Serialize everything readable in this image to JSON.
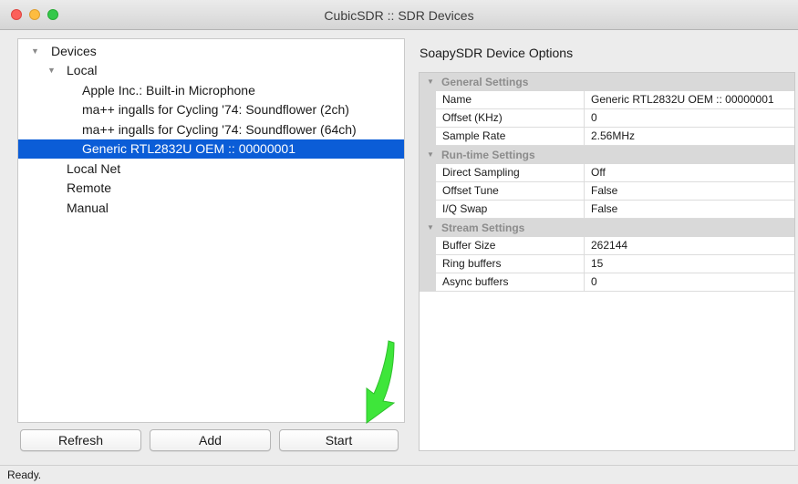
{
  "window": {
    "title": "CubicSDR :: SDR Devices"
  },
  "tree": {
    "root_label": "Devices",
    "local_label": "Local",
    "local_devices": [
      "Apple Inc.: Built-in Microphone",
      "ma++ ingalls for Cycling '74: Soundflower (2ch)",
      "ma++ ingalls for Cycling '74: Soundflower (64ch)",
      "Generic RTL2832U OEM :: 00000001"
    ],
    "selected_device": "Generic RTL2832U OEM :: 00000001",
    "local_net_label": "Local Net",
    "remote_label": "Remote",
    "manual_label": "Manual"
  },
  "buttons": {
    "refresh": "Refresh",
    "add": "Add",
    "start": "Start"
  },
  "options": {
    "title": "SoapySDR Device Options",
    "sections": [
      {
        "name": "General Settings",
        "rows": [
          {
            "name": "Name",
            "value": "Generic RTL2832U OEM :: 00000001"
          },
          {
            "name": "Offset (KHz)",
            "value": "0"
          },
          {
            "name": "Sample Rate",
            "value": "2.56MHz"
          }
        ]
      },
      {
        "name": "Run-time Settings",
        "rows": [
          {
            "name": "Direct Sampling",
            "value": "Off"
          },
          {
            "name": "Offset Tune",
            "value": "False"
          },
          {
            "name": "I/Q Swap",
            "value": "False"
          }
        ]
      },
      {
        "name": "Stream Settings",
        "rows": [
          {
            "name": "Buffer Size",
            "value": "262144"
          },
          {
            "name": "Ring buffers",
            "value": "15"
          },
          {
            "name": "Async buffers",
            "value": "0"
          }
        ]
      }
    ]
  },
  "status": {
    "text": "Ready."
  },
  "colors": {
    "selection": "#0b5dd7",
    "annotation_arrow": "#3ee63a",
    "close": "#fc605b",
    "minimize": "#fdbc40",
    "maximize": "#34c84a"
  },
  "icons": {
    "window_controls": [
      "close-icon",
      "minimize-icon",
      "maximize-icon"
    ],
    "tree_disclosure": "disclosure-triangle-icon",
    "annotation": "green-arrow-icon"
  }
}
